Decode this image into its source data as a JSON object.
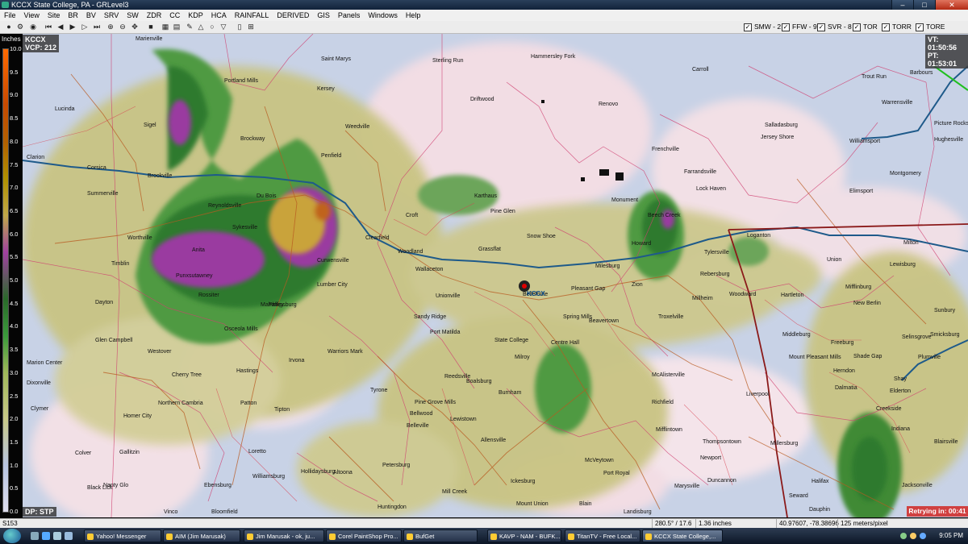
{
  "window": {
    "title": "KCCX State College, PA - GRLevel3",
    "minimize": "–",
    "maximize": "□",
    "close": "✕"
  },
  "menu": [
    "File",
    "View",
    "Site",
    "BR",
    "BV",
    "SRV",
    "SW",
    "ZDR",
    "CC",
    "KDP",
    "HCA",
    "RAINFALL",
    "DERIVED",
    "GIS",
    "Panels",
    "Windows",
    "Help"
  ],
  "toolbar": {
    "warnings": [
      {
        "label": "SMW - 2",
        "checked": true
      },
      {
        "label": "FFW - 9",
        "checked": true
      },
      {
        "label": "SVR - 8",
        "checked": true
      },
      {
        "label": "TOR",
        "checked": true
      },
      {
        "label": "TORR",
        "checked": true
      },
      {
        "label": "TORE",
        "checked": true
      }
    ]
  },
  "radar": {
    "site": "KCCX",
    "vcp": "VCP: 212",
    "vt": "VT: 01:50:56",
    "pt": "PT: 01:53:01",
    "product": "DP: STP",
    "retry": "Retrying in: 00:41",
    "site_marker": "KCCX"
  },
  "legend": {
    "unit": "Inches",
    "ticks": [
      "10.0",
      "9.5",
      "9.0",
      "8.5",
      "8.0",
      "7.5",
      "7.0",
      "6.5",
      "6.0",
      "5.5",
      "5.0",
      "4.5",
      "4.0",
      "3.5",
      "3.0",
      "2.5",
      "2.0",
      "1.5",
      "1.0",
      "0.5",
      "0.0"
    ]
  },
  "places": [
    "Marienville",
    "Saint Marys",
    "Sterling Run",
    "Hammersley Fork",
    "Carroll",
    "Trout Run",
    "Barbours",
    "Portland Mills",
    "Kersey",
    "Driftwood",
    "Renovo",
    "Lucinda",
    "Sigel",
    "Brockway",
    "Weedville",
    "Clarion",
    "Corsica",
    "Brookville",
    "Penfield",
    "Karthaus",
    "Farrandsville",
    "Salladasburg",
    "Jersey Shore",
    "Williamsport",
    "Warrensville",
    "Picture Rocks",
    "Summerville",
    "Reynoldsville",
    "Du Bois",
    "Frenchville",
    "Pine Glen",
    "Monument",
    "Lock Haven",
    "Elimsport",
    "Montgomery",
    "Hughesville",
    "Worthville",
    "Sykesville",
    "Croft",
    "Beech Creek",
    "Loganton",
    "Milton",
    "Lewisburg",
    "Timblin",
    "Anita",
    "Punxsutawney",
    "Clearfield",
    "Curwensville",
    "Woodland",
    "Snow Shoe",
    "Howard",
    "Tylersville",
    "Rebersburg",
    "Union",
    "New Berlin",
    "Sunbury",
    "Dayton",
    "Rossiter",
    "Lumber City",
    "Wallaceton",
    "Grassflat",
    "Milesburg",
    "Zion",
    "Millheim",
    "Woodward",
    "Hartleton",
    "Mifflinburg",
    "Selinsgrove",
    "Smicksburg",
    "Mahaffey",
    "Philipsburg",
    "Unionville",
    "Bellefonte",
    "Pleasant Gap",
    "Spring Mills",
    "Troxelville",
    "Middleburg",
    "Freeburg",
    "Shade Gap",
    "Plumville",
    "Glen Campbell",
    "Osceola Mills",
    "Sandy Ridge",
    "Port Matilda",
    "State College",
    "Centre Hall",
    "Beavertown",
    "Mount Pleasant Mills",
    "Herndon",
    "Shay",
    "Marion Center",
    "Westover",
    "Irvona",
    "Warriors Mark",
    "Boalsburg",
    "Milroy",
    "McAlisterville",
    "Dalmatia",
    "Elderton",
    "Dixonville",
    "Cherry Tree",
    "Hastings",
    "Tyrone",
    "Pine Grove Mills",
    "Reedsville",
    "Burnham",
    "Richfield",
    "Liverpool",
    "Creekside",
    "Clymer",
    "Northern Cambria",
    "Patton",
    "Tipton",
    "Bellwood",
    "Belleville",
    "Lewistown",
    "Mifflintown",
    "Thompsontown",
    "Millersburg",
    "Indiana",
    "Homer City",
    "Gallitzin",
    "Altoona",
    "Petersburg",
    "Allensville",
    "McVeytown",
    "Port Royal",
    "Newport",
    "Halifax",
    "Jacksonville",
    "Colver",
    "Loretto",
    "Hollidaysburg",
    "Huntingdon",
    "Ickesburg",
    "Duncannon",
    "Blairsville",
    "Black Lick",
    "Nanty Glo",
    "Ebensburg",
    "Williamsburg",
    "Mill Creek",
    "Mount Union",
    "Blain",
    "Landisburg",
    "Marysville",
    "Seward",
    "Vinco",
    "Bloomfield",
    "Dauphin"
  ],
  "status": {
    "left": "S153",
    "azimuth": "280.5° / 17.6 nm",
    "value": "1.36 inches",
    "coords": "40.97607, -78.38696",
    "scale": "125 meters/pixel"
  },
  "taskbar": {
    "items": [
      "Yahoo! Messenger",
      "AIM (Jim Marusak)",
      "Jim Marusak - ok, ju...",
      "Corel PaintShop Pro...",
      "BufGet",
      "KAVP - NAM - BUFK...",
      "TitanTV - Free Local...",
      "KCCX State College,..."
    ],
    "clock": "9:05 PM"
  }
}
